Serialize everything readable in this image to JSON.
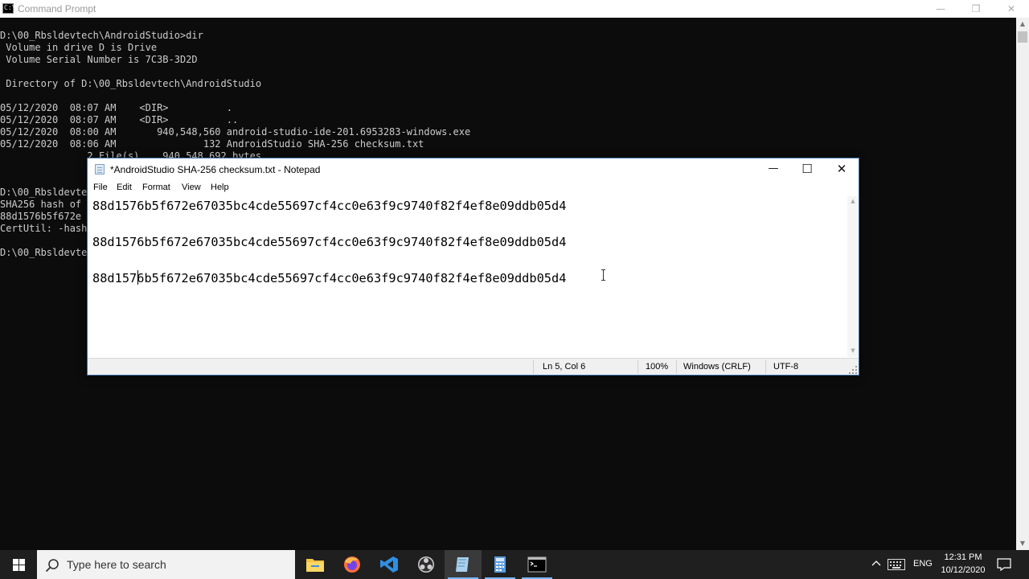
{
  "cmd": {
    "title": "Command Prompt",
    "title_icon_text": "C:\\",
    "controls": {
      "minimize": "—",
      "restore": "❐",
      "close": "✕"
    },
    "output_lines": [
      "D:\\00_Rbsldevtech\\AndroidStudio>dir",
      " Volume in drive D is Drive",
      " Volume Serial Number is 7C3B-3D2D",
      "",
      " Directory of D:\\00_Rbsldevtech\\AndroidStudio",
      "",
      "05/12/2020  08:07 AM    <DIR>          .",
      "05/12/2020  08:07 AM    <DIR>          ..",
      "05/12/2020  08:00 AM       940,548,560 android-studio-ide-201.6953283-windows.exe",
      "05/12/2020  08:06 AM               132 AndroidStudio SHA-256 checksum.txt",
      "               2 File(s)    940,548,692 bytes",
      "",
      "",
      "D:\\00_Rbsldevte",
      "SHA256 hash of",
      "88d1576b5f672e",
      "CertUtil: -hash",
      "",
      "D:\\00_Rbsldevte"
    ]
  },
  "notepad": {
    "title": "*AndroidStudio SHA-256 checksum.txt - Notepad",
    "controls": {
      "minimize": "—",
      "maximize": "☐",
      "close": "✕"
    },
    "menu": [
      "File",
      "Edit",
      "Format",
      "View",
      "Help"
    ],
    "lines": [
      "88d1576b5f672e67035bc4cde55697cf4cc0e63f9c9740f82f4ef8e09ddb05d4",
      "",
      "88d1576b5f672e67035bc4cde55697cf4cc0e63f9c9740f82f4ef8e09ddb05d4",
      "",
      "88d1576b5f672e67035bc4cde55697cf4cc0e63f9c9740f82f4ef8e09ddb05d4"
    ],
    "status": {
      "position": "Ln 5, Col 6",
      "zoom": "100%",
      "line_ending": "Windows (CRLF)",
      "encoding": "UTF-8"
    }
  },
  "taskbar": {
    "search_placeholder": "Type here to search",
    "apps": [
      {
        "name": "File Explorer",
        "icon": "folder-icon",
        "color": "#f7c244"
      },
      {
        "name": "Firefox",
        "icon": "firefox-icon",
        "color": "#ff7139"
      },
      {
        "name": "Visual Studio Code",
        "icon": "vscode-icon",
        "color": "#2f8fe3"
      },
      {
        "name": "OBS Studio",
        "icon": "obs-icon",
        "color": "#cfcfcf"
      },
      {
        "name": "Notepad",
        "icon": "notepad-icon",
        "color": "#a9d1ee"
      },
      {
        "name": "Calculator",
        "icon": "calculator-icon",
        "color": "#5a9de0"
      },
      {
        "name": "Command Prompt",
        "icon": "cmd-icon",
        "color": "#000000"
      }
    ],
    "tray": {
      "language": "ENG",
      "time": "12:31 PM",
      "date": "10/12/2020"
    }
  },
  "colors": {
    "cmd_background": "#0c0c0c",
    "cmd_text": "#cccccc",
    "taskbar": "#1f1f1f",
    "accent": "#77b7ff"
  }
}
